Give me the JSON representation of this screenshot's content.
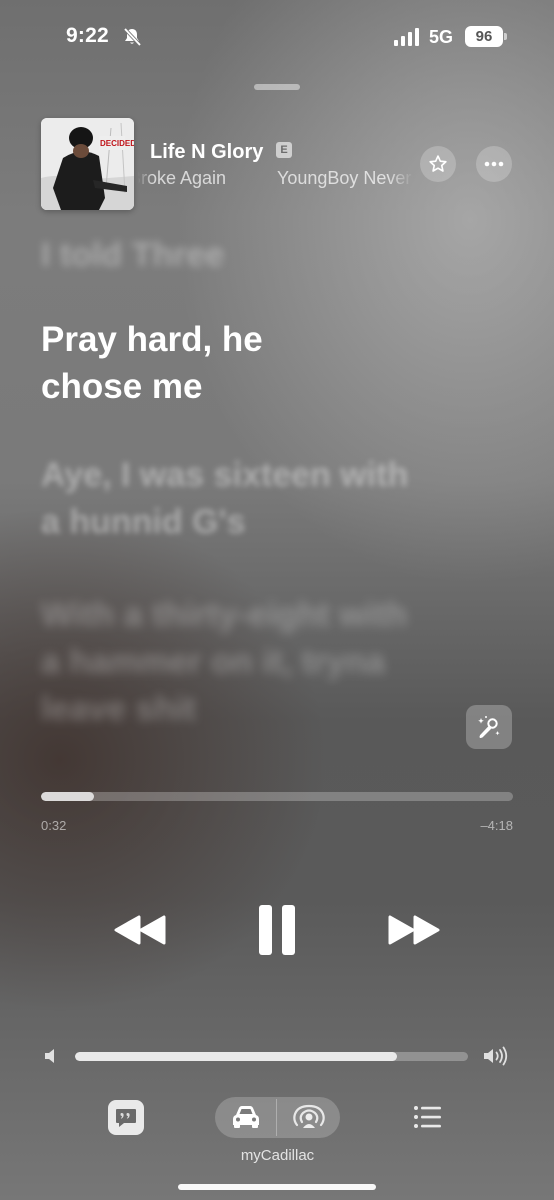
{
  "status_bar": {
    "time": "9:22",
    "network": "5G",
    "battery": "96",
    "icons": [
      "bell-slash-icon",
      "signal-icon"
    ]
  },
  "now_playing": {
    "artwork_text": "DECIDED",
    "title": "Life N Glory",
    "explicit_badge": "E",
    "album": "Broke Again",
    "artist": "YoungBoy Never Broke Again",
    "icons": [
      "star-icon",
      "ellipsis-icon"
    ]
  },
  "lyrics": {
    "previous": "I told Three",
    "current": "Pray hard, he chose me",
    "next": "Aye, I was sixteen with a hunnid G's",
    "next2": "With a thirty-eight with a hammer on it, tryna leave shit"
  },
  "playback": {
    "elapsed": "0:32",
    "remaining": "–4:18",
    "progress_fraction": 0.113,
    "controls": [
      "rewind-icon",
      "pause-icon",
      "fast-forward-icon"
    ],
    "sing_icon": "microphone-sparkle-icon"
  },
  "volume": {
    "level_fraction": 0.82
  },
  "bottom_bar": {
    "device_label": "myCadillac",
    "icons": [
      "lyrics-quote-icon",
      "car-icon",
      "broadcast-icon",
      "queue-list-icon"
    ]
  },
  "colors": {
    "primary_text": "#ffffff",
    "secondary_text": "rgba(255,255,255,0.7)",
    "background_top": "#6f6f6f",
    "background_bottom": "#595959"
  }
}
